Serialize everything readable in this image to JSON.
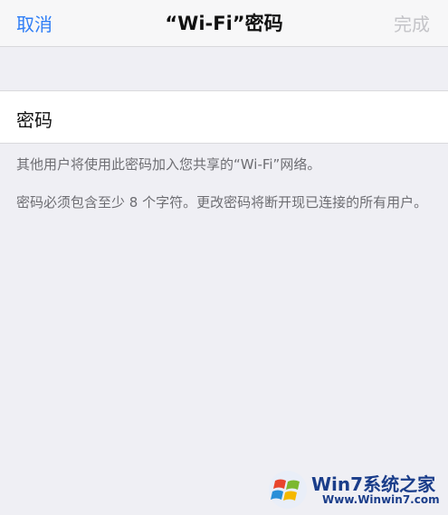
{
  "navbar": {
    "cancel_label": "取消",
    "title": "“Wi-Fi”密码",
    "done_label": "完成"
  },
  "password_field": {
    "label": "密码",
    "value": ""
  },
  "help": {
    "line1": "其他用户将使用此密码加入您共享的“Wi-Fi”网络。",
    "line2": "密码必须包含至少 8 个字符。更改密码将断开现已连接的所有用户。"
  },
  "watermark": {
    "title": "Win7系统之家",
    "url": "Www.Winwin7.com"
  },
  "colors": {
    "accent": "#2f7ef6",
    "disabled": "#c4c4c8",
    "background": "#efeff4",
    "help_text": "#6d6d72"
  }
}
